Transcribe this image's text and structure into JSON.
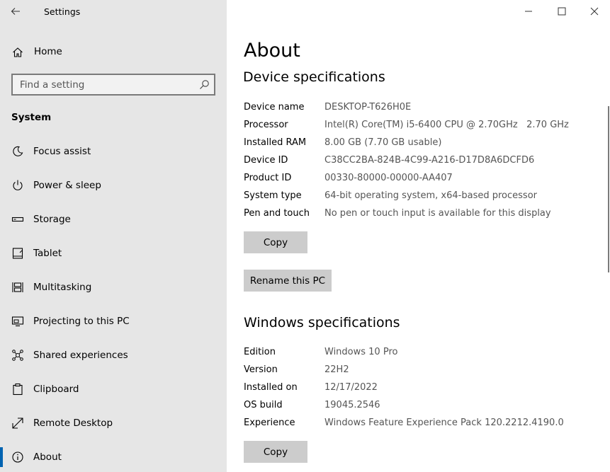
{
  "app": {
    "title": "Settings"
  },
  "sidebar": {
    "home_label": "Home",
    "search_placeholder": "Find a setting",
    "section_label": "System",
    "items": [
      {
        "label": "Focus assist",
        "icon": "moon-icon"
      },
      {
        "label": "Power & sleep",
        "icon": "power-icon"
      },
      {
        "label": "Storage",
        "icon": "storage-icon"
      },
      {
        "label": "Tablet",
        "icon": "tablet-icon"
      },
      {
        "label": "Multitasking",
        "icon": "multitasking-icon"
      },
      {
        "label": "Projecting to this PC",
        "icon": "projector-icon"
      },
      {
        "label": "Shared experiences",
        "icon": "shared-icon"
      },
      {
        "label": "Clipboard",
        "icon": "clipboard-icon"
      },
      {
        "label": "Remote Desktop",
        "icon": "remote-icon"
      },
      {
        "label": "About",
        "icon": "info-icon",
        "selected": true
      }
    ],
    "accent_color": "#0063b1"
  },
  "main": {
    "title": "About",
    "device": {
      "heading": "Device specifications",
      "rows": [
        {
          "key": "Device name",
          "value": "DESKTOP-T626H0E"
        },
        {
          "key": "Processor",
          "value": "Intel(R) Core(TM) i5-6400 CPU @ 2.70GHz   2.70 GHz"
        },
        {
          "key": "Installed RAM",
          "value": "8.00 GB (7.70 GB usable)"
        },
        {
          "key": "Device ID",
          "value": "C38CC2BA-824B-4C99-A216-D17D8A6DCFD6"
        },
        {
          "key": "Product ID",
          "value": "00330-80000-00000-AA407"
        },
        {
          "key": "System type",
          "value": "64-bit operating system, x64-based processor"
        },
        {
          "key": "Pen and touch",
          "value": "No pen or touch input is available for this display"
        }
      ],
      "copy_label": "Copy",
      "rename_label": "Rename this PC"
    },
    "windows": {
      "heading": "Windows specifications",
      "rows": [
        {
          "key": "Edition",
          "value": "Windows 10 Pro"
        },
        {
          "key": "Version",
          "value": "22H2"
        },
        {
          "key": "Installed on",
          "value": "12/17/2022"
        },
        {
          "key": "OS build",
          "value": "19045.2546"
        },
        {
          "key": "Experience",
          "value": "Windows Feature Experience Pack 120.2212.4190.0"
        }
      ],
      "copy_label": "Copy"
    }
  }
}
